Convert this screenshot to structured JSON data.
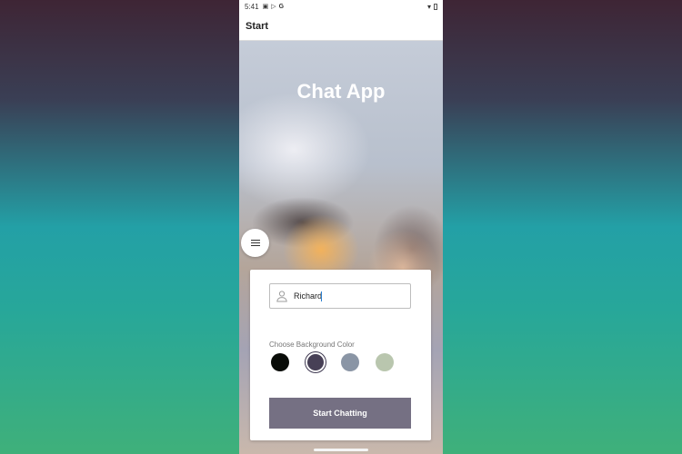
{
  "status_bar": {
    "time": "5:41",
    "icons": [
      "notification-icon",
      "play-store-icon",
      "google-icon",
      "wifi-icon",
      "battery-icon"
    ]
  },
  "app_bar": {
    "title": "Start"
  },
  "main": {
    "app_title": "Chat App",
    "name_input": {
      "value": "Richard",
      "icon": "person-icon"
    },
    "choose_label": "Choose Background Color",
    "colors": [
      {
        "name": "black",
        "hex": "#090C08",
        "selected": false
      },
      {
        "name": "purple",
        "hex": "#474056",
        "selected": true
      },
      {
        "name": "grey-blue",
        "hex": "#8A95A5",
        "selected": false
      },
      {
        "name": "green",
        "hex": "#B9C6AE",
        "selected": false
      }
    ],
    "start_button": "Start Chatting",
    "menu_icon": "hamburger-menu-icon"
  }
}
